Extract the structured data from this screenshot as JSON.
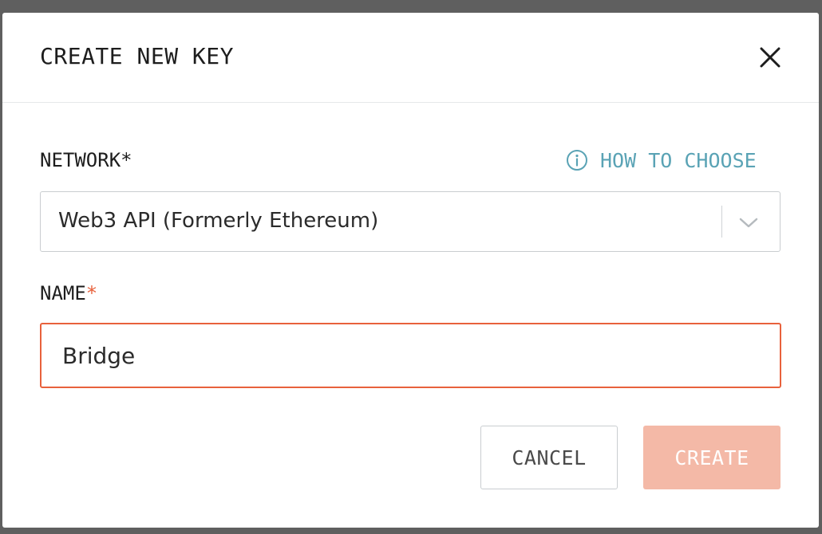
{
  "modal": {
    "title": "CREATE NEW KEY",
    "close_icon": "close-icon"
  },
  "network": {
    "label": "NETWORK*",
    "help_link": "HOW TO CHOOSE",
    "help_icon": "info-icon",
    "selected_value": "Web3 API (Formerly Ethereum)",
    "dropdown_icon": "chevron-down-icon"
  },
  "name": {
    "label": "NAME",
    "required_marker": "*",
    "value": "Bridge"
  },
  "actions": {
    "cancel_label": "CANCEL",
    "create_label": "CREATE"
  },
  "colors": {
    "accent": "#e8613c",
    "create_disabled_bg": "#f4b9a7",
    "link": "#5aa3b5",
    "overlay": "#5f5f5f"
  }
}
